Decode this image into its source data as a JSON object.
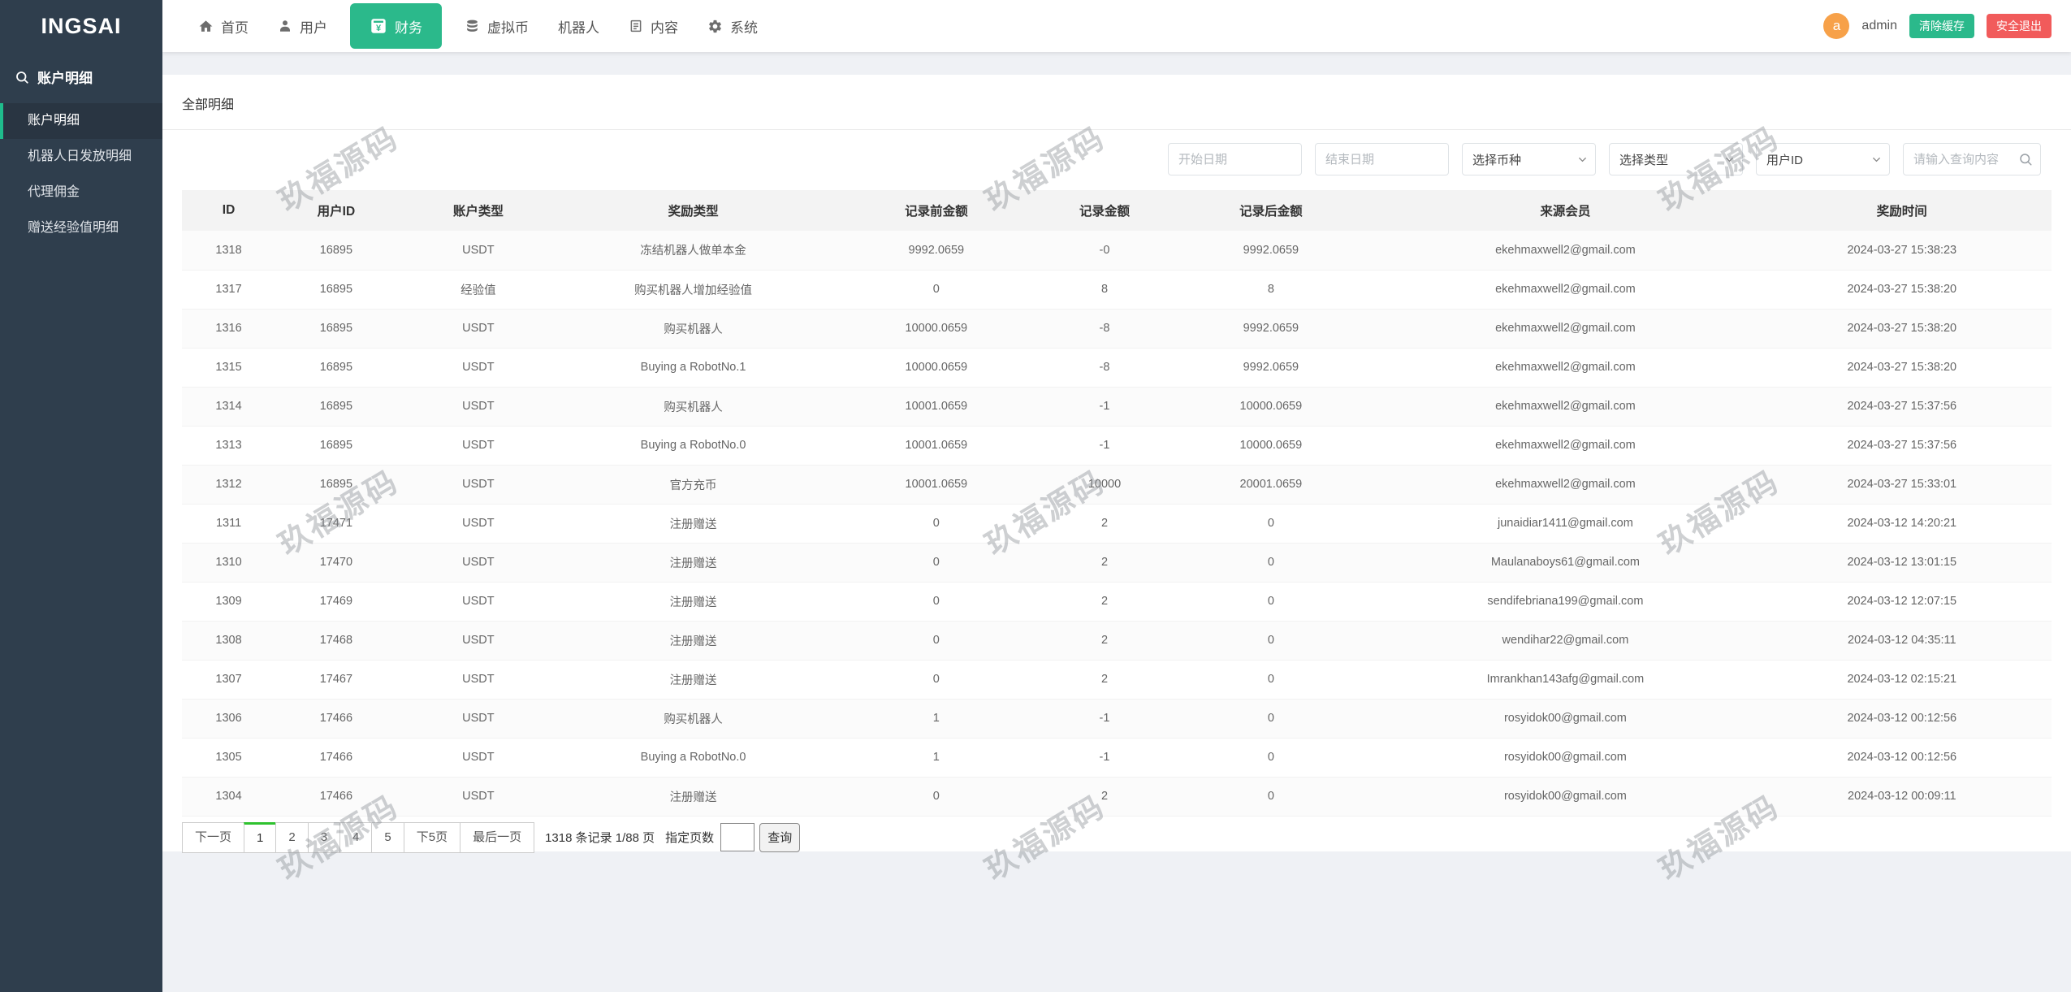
{
  "app": {
    "logo": "INGSAI"
  },
  "sidebar": {
    "section_label": "账户明细",
    "items": [
      {
        "label": "账户明细",
        "name": "sidebar-item-account-detail",
        "active": true
      },
      {
        "label": "机器人日发放明细",
        "name": "sidebar-item-robot-daily-release"
      },
      {
        "label": "代理佣金",
        "name": "sidebar-item-agent-commission"
      },
      {
        "label": "赠送经验值明细",
        "name": "sidebar-item-gift-exp-detail"
      }
    ]
  },
  "topnav": {
    "items": [
      {
        "label": "首页",
        "name": "top-nav-home",
        "icon": "home-icon"
      },
      {
        "label": "用户",
        "name": "top-nav-users",
        "icon": "user-icon"
      },
      {
        "label": "财务",
        "name": "top-nav-finance",
        "icon": "finance-icon",
        "active": true
      },
      {
        "label": "虚拟币",
        "name": "top-nav-crypto",
        "icon": "coins-icon"
      },
      {
        "label": "机器人",
        "name": "top-nav-robot"
      },
      {
        "label": "内容",
        "name": "top-nav-content",
        "icon": "content-icon"
      },
      {
        "label": "系统",
        "name": "top-nav-system",
        "icon": "gear-icon"
      }
    ],
    "user": {
      "avatar_letter": "a",
      "name": "admin"
    },
    "clear_cache_label": "清除缓存",
    "logout_label": "安全退出"
  },
  "panel": {
    "title": "全部明细"
  },
  "filters": {
    "start_date_placeholder": "开始日期",
    "end_date_placeholder": "结束日期",
    "coin_select_value": "选择币种",
    "type_select_value": "选择类型",
    "field_select_value": "用户ID",
    "search_placeholder": "请输入查询内容"
  },
  "table": {
    "columns": [
      "ID",
      "用户ID",
      "账户类型",
      "奖励类型",
      "记录前金额",
      "记录金额",
      "记录后金额",
      "来源会员",
      "奖励时间"
    ],
    "rows": [
      [
        "1318",
        "16895",
        "USDT",
        "冻结机器人做单本金",
        "9992.0659",
        "-0",
        "9992.0659",
        "ekehmaxwell2@gmail.com",
        "2024-03-27 15:38:23"
      ],
      [
        "1317",
        "16895",
        "经验值",
        "购买机器人增加经验值",
        "0",
        "8",
        "8",
        "ekehmaxwell2@gmail.com",
        "2024-03-27 15:38:20"
      ],
      [
        "1316",
        "16895",
        "USDT",
        "购买机器人",
        "10000.0659",
        "-8",
        "9992.0659",
        "ekehmaxwell2@gmail.com",
        "2024-03-27 15:38:20"
      ],
      [
        "1315",
        "16895",
        "USDT",
        "Buying a RobotNo.1",
        "10000.0659",
        "-8",
        "9992.0659",
        "ekehmaxwell2@gmail.com",
        "2024-03-27 15:38:20"
      ],
      [
        "1314",
        "16895",
        "USDT",
        "购买机器人",
        "10001.0659",
        "-1",
        "10000.0659",
        "ekehmaxwell2@gmail.com",
        "2024-03-27 15:37:56"
      ],
      [
        "1313",
        "16895",
        "USDT",
        "Buying a RobotNo.0",
        "10001.0659",
        "-1",
        "10000.0659",
        "ekehmaxwell2@gmail.com",
        "2024-03-27 15:37:56"
      ],
      [
        "1312",
        "16895",
        "USDT",
        "官方充币",
        "10001.0659",
        "10000",
        "20001.0659",
        "ekehmaxwell2@gmail.com",
        "2024-03-27 15:33:01"
      ],
      [
        "1311",
        "17471",
        "USDT",
        "注册赠送",
        "0",
        "2",
        "0",
        "junaidiar1411@gmail.com",
        "2024-03-12 14:20:21"
      ],
      [
        "1310",
        "17470",
        "USDT",
        "注册赠送",
        "0",
        "2",
        "0",
        "Maulanaboys61@gmail.com",
        "2024-03-12 13:01:15"
      ],
      [
        "1309",
        "17469",
        "USDT",
        "注册赠送",
        "0",
        "2",
        "0",
        "sendifebriana199@gmail.com",
        "2024-03-12 12:07:15"
      ],
      [
        "1308",
        "17468",
        "USDT",
        "注册赠送",
        "0",
        "2",
        "0",
        "wendihar22@gmail.com",
        "2024-03-12 04:35:11"
      ],
      [
        "1307",
        "17467",
        "USDT",
        "注册赠送",
        "0",
        "2",
        "0",
        "Imrankhan143afg@gmail.com",
        "2024-03-12 02:15:21"
      ],
      [
        "1306",
        "17466",
        "USDT",
        "购买机器人",
        "1",
        "-1",
        "0",
        "rosyidok00@gmail.com",
        "2024-03-12 00:12:56"
      ],
      [
        "1305",
        "17466",
        "USDT",
        "Buying a RobotNo.0",
        "1",
        "-1",
        "0",
        "rosyidok00@gmail.com",
        "2024-03-12 00:12:56"
      ],
      [
        "1304",
        "17466",
        "USDT",
        "注册赠送",
        "0",
        "2",
        "0",
        "rosyidok00@gmail.com",
        "2024-03-12 00:09:11"
      ]
    ]
  },
  "pagination": {
    "prev_label": "下一页",
    "pages": [
      {
        "label": "1",
        "name": "page-1",
        "active": true
      },
      {
        "label": "2",
        "name": "page-2"
      },
      {
        "label": "3",
        "name": "page-3"
      },
      {
        "label": "4",
        "name": "page-4"
      },
      {
        "label": "5",
        "name": "page-5"
      }
    ],
    "next5_label": "下5页",
    "last_label": "最后一页",
    "record_summary": "1318 条记录 1/88 页",
    "goto_label": "指定页数",
    "goto_input_value": "",
    "query_label": "查询"
  },
  "watermark": {
    "text": "玖福源码"
  },
  "colors": {
    "theme_green": "#2bb98b",
    "danger_red": "#f15b5b",
    "avatar_orange": "#f7a149",
    "sidebar_dark": "#2f3e4d",
    "page_active_green": "#2ec22e"
  }
}
